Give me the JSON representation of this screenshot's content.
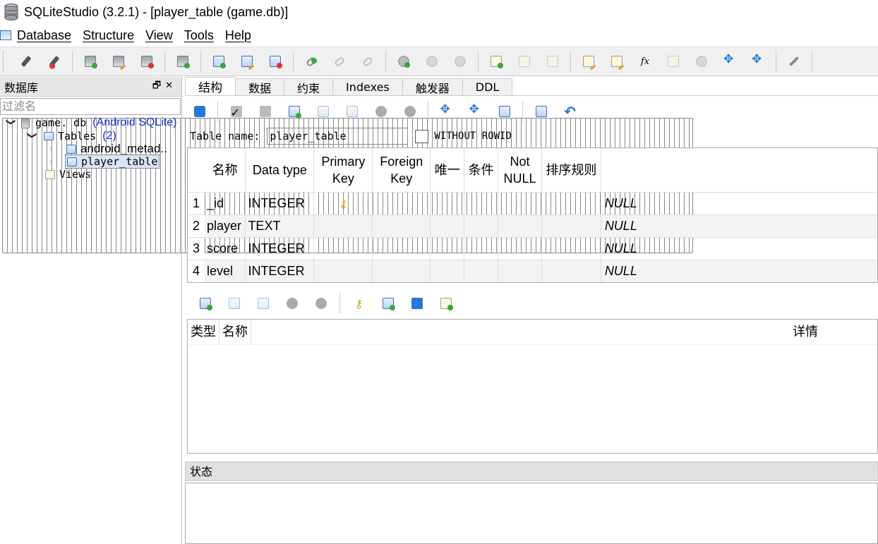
{
  "window": {
    "title": "SQLiteStudio (3.2.1) - [player_table (game.db)]"
  },
  "menu": [
    "Database",
    "Structure",
    "View",
    "Tools",
    "Help"
  ],
  "toolbar_icons": [
    "disconnect-icon",
    "connect-icon",
    "add-database-icon",
    "edit-database-icon",
    "remove-database-icon",
    "refresh-database-icon",
    "add-table-icon",
    "edit-table-icon",
    "delete-table-icon",
    "add-index-icon",
    "edit-index-icon",
    "delete-index-icon",
    "add-trigger-icon",
    "edit-trigger-icon",
    "delete-trigger-icon",
    "add-view-icon",
    "edit-view-icon",
    "delete-view-icon",
    "sql-editor-icon",
    "ddl-history-icon",
    "functions-icon",
    "collations-icon",
    "extensions-icon",
    "collapse-icon",
    "expand-icon",
    "settings-icon",
    "tile-icon",
    "cascade-icon"
  ],
  "db_panel": {
    "title": "数据库",
    "filter_placeholder": "过滤名",
    "db_name": "game. db",
    "db_type": "(Android SQLite)",
    "tables_label": "Tables",
    "tables_count": "(2)",
    "table1": "android_metad..",
    "table2": "player_table",
    "views_label": "Views"
  },
  "tabs": [
    "结构",
    "数据",
    "约束",
    "Indexes",
    "触发器",
    "DDL"
  ],
  "table_name_label": "Table name:",
  "table_name_value": "player_table",
  "without_rowid_label": "WITHOUT ROWID",
  "columns_header": [
    "名称",
    "Data type",
    "Primary Key",
    "Foreign Key",
    "唯一",
    "条件",
    "Not NULL",
    "排序规则"
  ],
  "columns": [
    {
      "n": "1",
      "name": "_id",
      "type": "INTEGER",
      "pk": true,
      "default": "NULL"
    },
    {
      "n": "2",
      "name": "player",
      "type": "TEXT",
      "pk": false,
      "default": "NULL"
    },
    {
      "n": "3",
      "name": "score",
      "type": "INTEGER",
      "pk": false,
      "default": "NULL"
    },
    {
      "n": "4",
      "name": "level",
      "type": "INTEGER",
      "pk": false,
      "default": "NULL"
    }
  ],
  "constraints_header": {
    "type": "类型",
    "name": "名称",
    "details": "详情"
  },
  "status_title": "状态"
}
